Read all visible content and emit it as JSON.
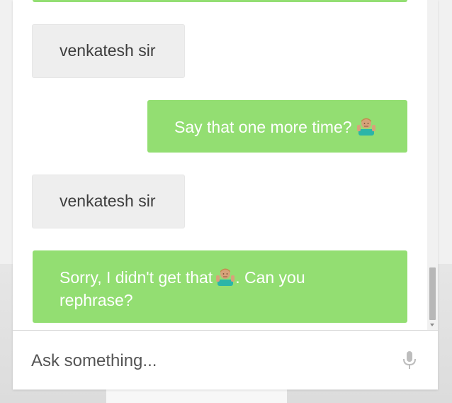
{
  "chat": {
    "messages": [
      {
        "sender": "bot",
        "text": "venkatesh sir"
      },
      {
        "sender": "user",
        "text": "Say that one more time?",
        "emoji": "man-shrugging-emoji"
      },
      {
        "sender": "bot",
        "text": "venkatesh sir"
      },
      {
        "sender": "user",
        "text_before": "Sorry, I didn't get that",
        "emoji": "man-shrugging-emoji",
        "text_after": ". Can you",
        "text_line2": "rephrase?"
      }
    ]
  },
  "input": {
    "placeholder": "Ask something...",
    "value": ""
  },
  "icons": {
    "mic": "microphone-icon"
  },
  "colors": {
    "user_bubble": "#93de72",
    "bot_bubble": "#eeeeee",
    "bot_text": "#3c3c3c",
    "user_text": "#ffffff",
    "mic": "#bdbdbd"
  },
  "scrollbar": {
    "position_fraction": 0.93
  }
}
